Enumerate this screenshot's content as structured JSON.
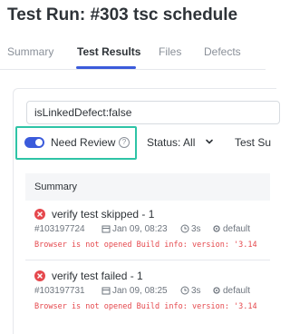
{
  "header": {
    "title": "Test Run: #303 tsc schedule"
  },
  "tabs": [
    {
      "label": "Summary",
      "active": false
    },
    {
      "label": "Test Results",
      "active": true
    },
    {
      "label": "Files",
      "active": false
    },
    {
      "label": "Defects",
      "active": false
    }
  ],
  "filter": {
    "search_value": "isLinkedDefect:false",
    "need_review_label": "Need Review",
    "need_review_on": true,
    "status_label": "Status: All",
    "test_label": "Test Su"
  },
  "table": {
    "header": "Summary",
    "rows": [
      {
        "name": "verify test skipped - 1",
        "id": "#103197724",
        "date": "Jan 09, 08:23",
        "duration": "3s",
        "env": "default",
        "error": "Browser is not opened Build info: version: '3.14"
      },
      {
        "name": "verify test failed - 1",
        "id": "#103197731",
        "date": "Jan 09, 08:25",
        "duration": "3s",
        "env": "default",
        "error": "Browser is not opened Build info: version: '3.14"
      }
    ]
  },
  "colors": {
    "accent": "#3b5bdb",
    "highlight": "#2ec4a6",
    "error": "#e5484d"
  }
}
